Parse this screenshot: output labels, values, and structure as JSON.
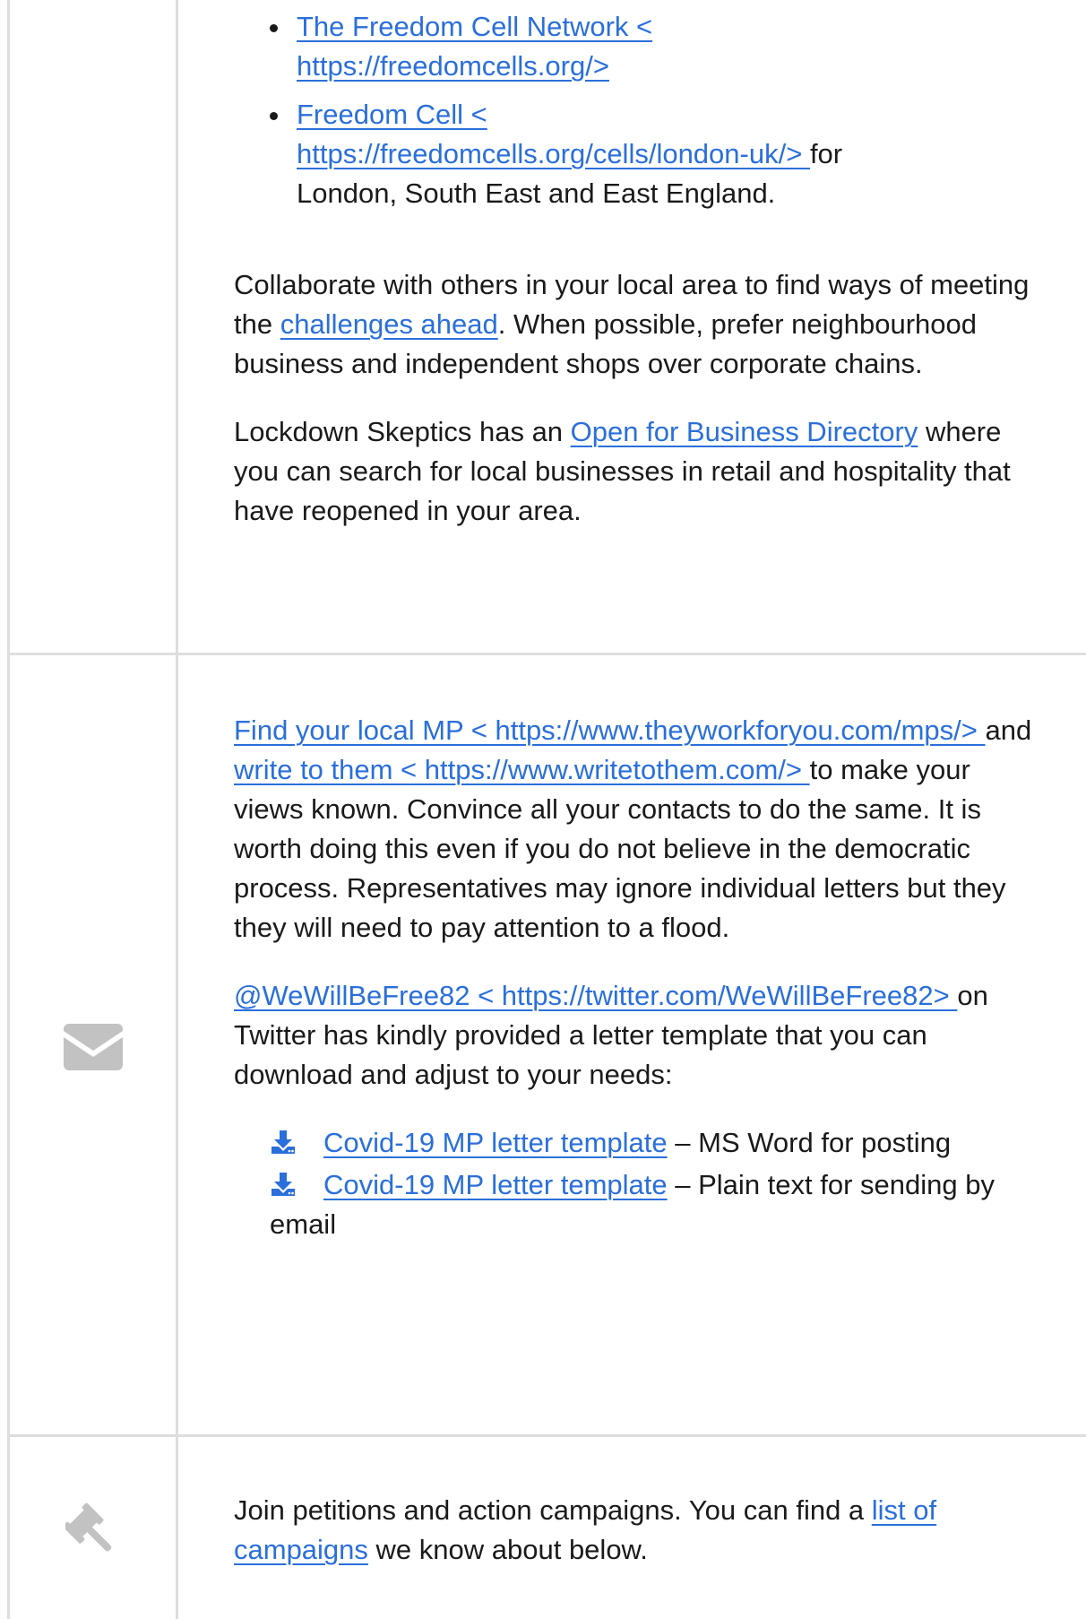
{
  "section1": {
    "list": [
      {
        "link_title": "The Freedom Cell Network <",
        "link_url": "https://freedomcells.org/>",
        "suffix": ""
      },
      {
        "link_title": "Freedom Cell <",
        "link_url": "https://freedomcells.org/cells/london-uk/> ",
        "suffix_inline": "for",
        "suffix_line2": "London, South East and East England."
      }
    ],
    "para1": {
      "before": "Collaborate with others in your local area to find ways of meeting the ",
      "link": "challenges ahead",
      "after": ". When possible, prefer neighbourhood business and independent shops over corporate chains."
    },
    "para2": {
      "before": "Lockdown Skeptics has an ",
      "link": "Open for Business Directory",
      "after": " where you can search for local businesses in retail and hospitality that have reopened in your area."
    }
  },
  "section2": {
    "icon": "envelope-icon",
    "para1": {
      "link1": "Find your local MP < https://www.theyworkforyou.com/mps/> ",
      "mid": "and ",
      "link2": "write to them < https://www.writetothem.com/> ",
      "after": "to make your views known. Convince all your contacts to do the same. It is worth doing this even if you do not believe in the democratic process. Representatives may ignore individual letters but they they will need to pay attention to a flood."
    },
    "para2": {
      "link": "@WeWillBeFree82 < https://twitter.com/WeWillBeFree82> ",
      "after": "on Twitter has kindly provided a letter template that you can download and adjust to your needs:"
    },
    "downloads": [
      {
        "icon": "download-icon",
        "link": "Covid-19 MP letter template",
        "desc": " – MS Word for posting"
      },
      {
        "icon": "download-icon",
        "link": "Covid-19 MP letter template",
        "desc": " – Plain text for sending by email"
      }
    ]
  },
  "section3": {
    "icon": "gavel-icon",
    "para": {
      "before": "Join petitions and action campaigns. You can find a ",
      "link": "list of campaigns",
      "after": " we know about below."
    }
  },
  "colors": {
    "link": "#2a6fdb",
    "text": "#1a1a1a",
    "border": "#dedede",
    "icon_gray": "#c2c2c2"
  }
}
